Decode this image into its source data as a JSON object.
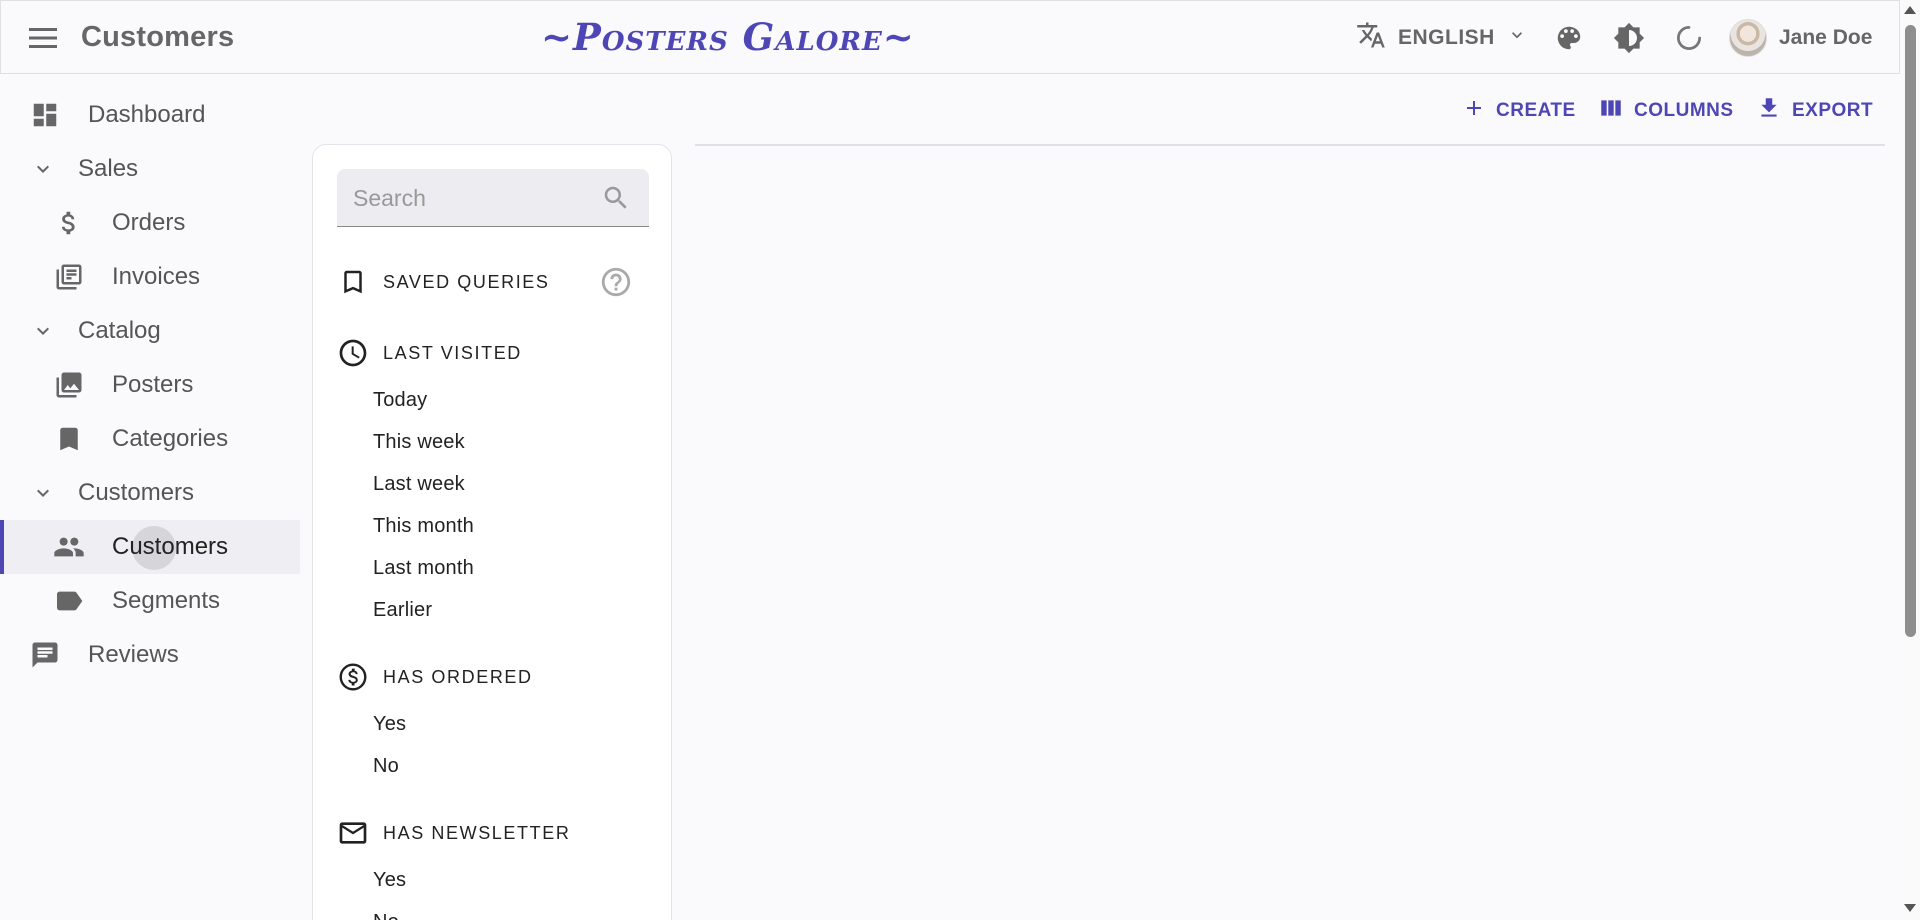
{
  "appbar": {
    "page_title": "Customers",
    "brand": "~Posters Galore~",
    "language": "ENGLISH",
    "user_name": "Jane Doe"
  },
  "sidebar": {
    "dashboard": "Dashboard",
    "sales": "Sales",
    "orders": "Orders",
    "invoices": "Invoices",
    "catalog": "Catalog",
    "posters": "Posters",
    "categories": "Categories",
    "customers_group": "Customers",
    "customers": "Customers",
    "segments": "Segments",
    "reviews": "Reviews"
  },
  "filters": {
    "search_placeholder": "Search",
    "saved_queries": "SAVED QUERIES",
    "last_visited": {
      "title": "LAST VISITED",
      "items": [
        "Today",
        "This week",
        "Last week",
        "This month",
        "Last month",
        "Earlier"
      ]
    },
    "has_ordered": {
      "title": "HAS ORDERED",
      "items": [
        "Yes",
        "No"
      ]
    },
    "has_newsletter": {
      "title": "HAS NEWSLETTER",
      "items": [
        "Yes",
        "No"
      ]
    }
  },
  "toolbar": {
    "create": "CREATE",
    "columns": "COLUMNS",
    "export": "EXPORT"
  },
  "colors": {
    "accent": "#4f46b5",
    "background": "#fafafd",
    "text_muted": "#666666"
  }
}
